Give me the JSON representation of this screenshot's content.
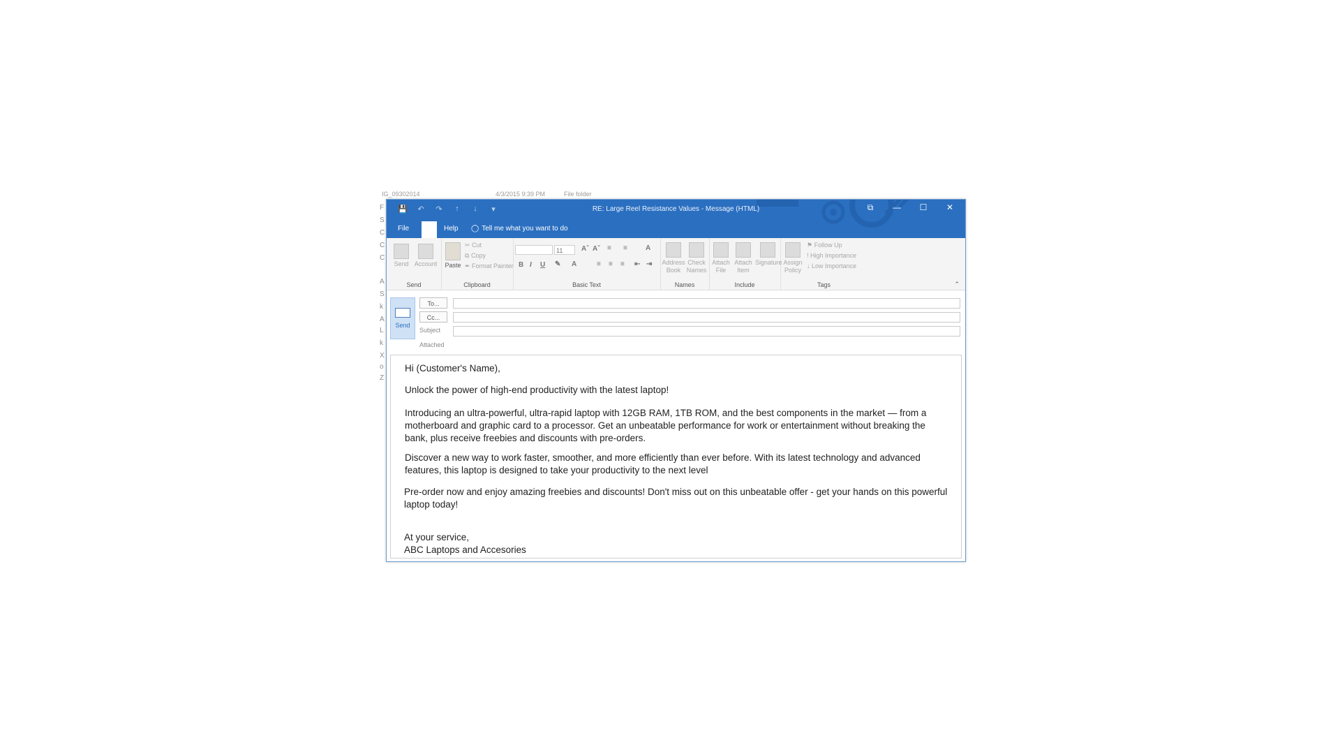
{
  "background": {
    "top_texts": [
      "IG_09302014",
      "4/3/2015 9:39 PM",
      "File folder"
    ],
    "side_letters": [
      "F",
      "S",
      "C",
      "C",
      "C",
      "A",
      "S",
      "k",
      "A",
      "L",
      "k",
      "X",
      "o",
      "Z"
    ]
  },
  "window": {
    "title": "RE: Large Reel Resistance Values  -  Message (HTML)",
    "accent_color": "#2b6fc0",
    "quick_access_icons": [
      "save-icon",
      "undo-icon",
      "redo-icon",
      "up-arrow-icon",
      "down-arrow-icon",
      "customize-icon"
    ],
    "controls": {
      "restore_ribbon": "⧉",
      "minimize": "—",
      "maximize": "☐",
      "close": "✕"
    }
  },
  "tabs": {
    "file": "File",
    "help": "Help",
    "tell_me": "Tell me what you want to do"
  },
  "ribbon": {
    "send_group": {
      "label": "Send",
      "send": "Send",
      "account": "Account"
    },
    "clipboard_group": {
      "label": "Clipboard",
      "paste": "Paste",
      "cut": "Cut",
      "copy": "Copy",
      "format_painter": "Format Painter"
    },
    "basic_text_group": {
      "label": "Basic Text",
      "font_size": "11"
    },
    "names_group": {
      "label": "Names",
      "address_book_1": "Address",
      "address_book_2": "Book",
      "check_names_1": "Check",
      "check_names_2": "Names"
    },
    "include_group": {
      "label": "Include",
      "attach_file_1": "Attach",
      "attach_file_2": "File",
      "attach_item_1": "Attach",
      "attach_item_2": "Item",
      "signature": "Signature"
    },
    "tags_group": {
      "label": "Tags",
      "assign_policy_1": "Assign",
      "assign_policy_2": "Policy",
      "follow_up": "Follow Up",
      "high_importance": "High Importance",
      "low_importance": "Low Importance"
    }
  },
  "header": {
    "send": "Send",
    "to": "To...",
    "cc": "Cc...",
    "subject": "Subject",
    "attached": "Attached"
  },
  "email_body": {
    "greeting": "Hi (Customer's Name),",
    "line1": "Unlock the power of high-end productivity with the latest laptop!",
    "para1": "Introducing an ultra-powerful, ultra-rapid laptop with 12GB RAM, 1TB ROM, and the best components in the market — from a motherboard and graphic card to a processor. Get an unbeatable performance for work or entertainment without breaking the bank, plus receive freebies and discounts with pre-orders.",
    "para2": "Discover a new way to work faster, smoother, and more efficiently than ever before. With its latest technology and advanced features, this laptop is designed to take your productivity to the next level",
    "para3": "Pre-order now and enjoy amazing freebies and discounts! Don't miss out on this unbeatable offer - get your hands on this powerful laptop today!",
    "signoff": "At your service,",
    "signature": "ABC Laptops and Accesories"
  }
}
